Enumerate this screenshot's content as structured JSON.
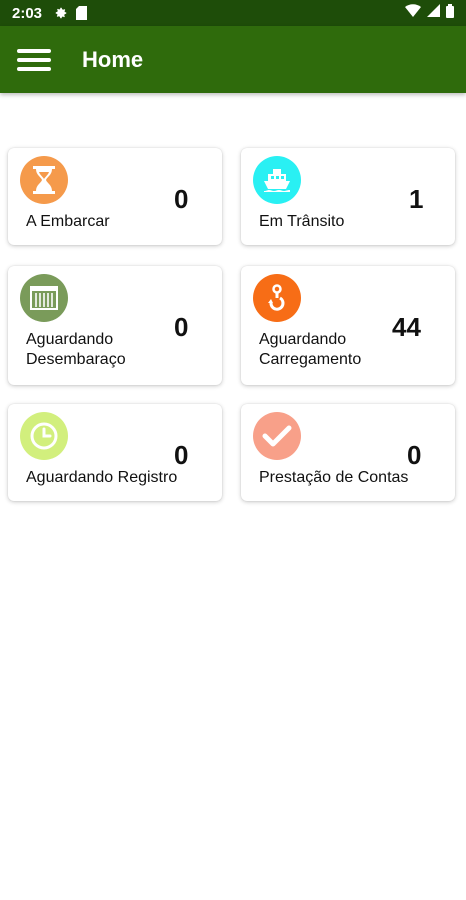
{
  "status_bar": {
    "time": "2:03",
    "icons": [
      "settings-icon",
      "sim-card-icon",
      "wifi-icon",
      "signal-icon",
      "battery-icon"
    ]
  },
  "app_bar": {
    "title": "Home",
    "menu_icon": "hamburger-menu-icon",
    "color": "#2f6b0c"
  },
  "cards": [
    {
      "label": "A Embarcar",
      "count": "0",
      "icon": "hourglass-icon",
      "icon_color": "#f59a4b"
    },
    {
      "label": "Em Trânsito",
      "count": "1",
      "icon": "ship-icon",
      "icon_color": "#29f0f3"
    },
    {
      "label": "Aguardando\nDesembaraço",
      "count": "0",
      "icon": "container-icon",
      "icon_color": "#7a9b5a"
    },
    {
      "label": "Aguardando\nCarregamento",
      "count": "44",
      "icon": "crane-hook-icon",
      "icon_color": "#f76d16"
    },
    {
      "label": "Aguardando Registro",
      "count": "0",
      "icon": "clock-icon",
      "icon_color": "#d2ef7d"
    },
    {
      "label": "Prestação de Contas",
      "count": "0",
      "icon": "checkmark-icon",
      "icon_color": "#f8a089"
    }
  ]
}
